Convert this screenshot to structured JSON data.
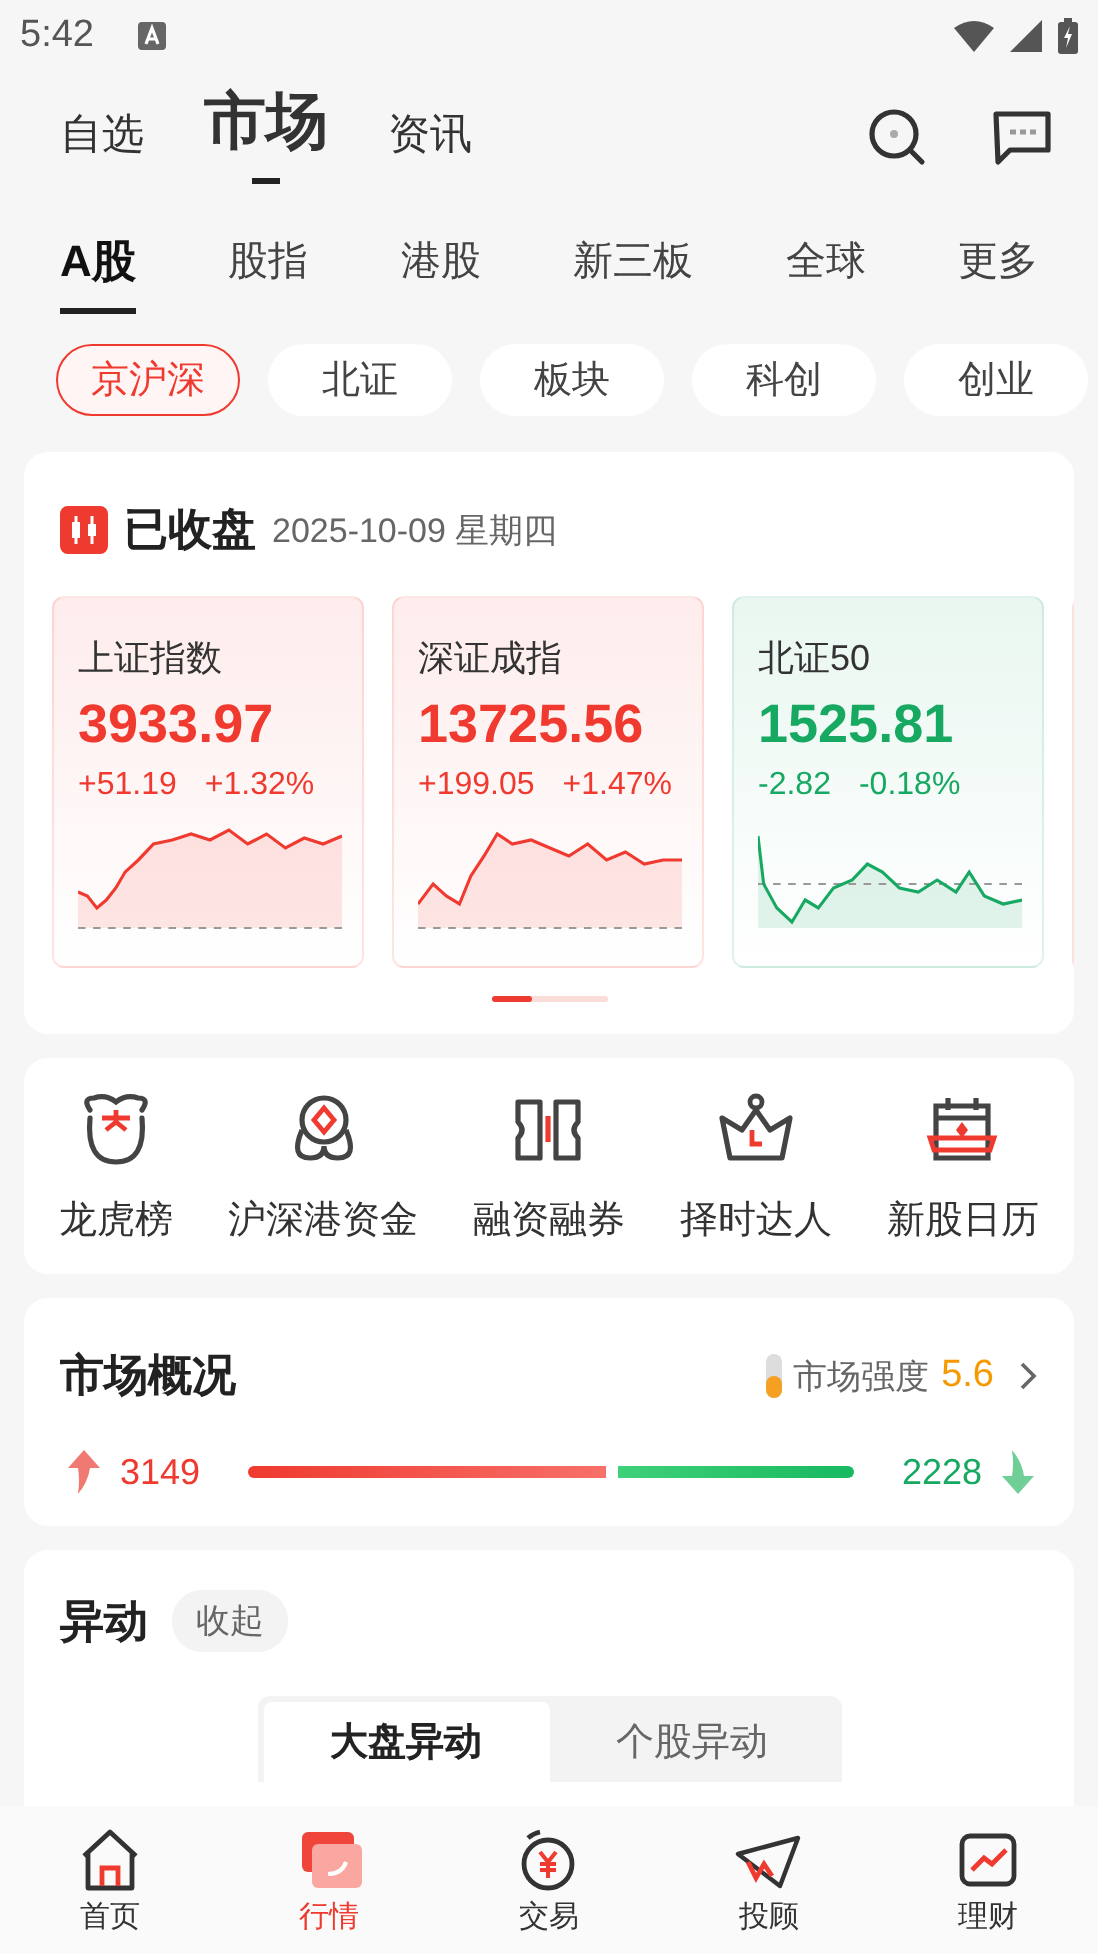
{
  "status_bar": {
    "time": "5:42"
  },
  "header_tabs": [
    {
      "label": "自选",
      "selected": false
    },
    {
      "label": "市场",
      "selected": true
    },
    {
      "label": "资讯",
      "selected": false
    }
  ],
  "market_tabs": [
    {
      "label": "A股",
      "selected": true
    },
    {
      "label": "股指",
      "selected": false
    },
    {
      "label": "港股",
      "selected": false
    },
    {
      "label": "新三板",
      "selected": false
    },
    {
      "label": "全球",
      "selected": false
    },
    {
      "label": "更多",
      "selected": false
    }
  ],
  "sub_tabs": [
    {
      "label": "京沪深",
      "selected": true
    },
    {
      "label": "北证",
      "selected": false
    },
    {
      "label": "板块",
      "selected": false
    },
    {
      "label": "科创",
      "selected": false
    },
    {
      "label": "创业",
      "selected": false
    }
  ],
  "session": {
    "status": "已收盘",
    "date": "2025-10-09 星期四"
  },
  "indices": [
    {
      "name": "上证指数",
      "value": "3933.97",
      "change": "+51.19",
      "percent": "+1.32%",
      "color": "#f0392f"
    },
    {
      "name": "深证成指",
      "value": "13725.56",
      "change": "+199.05",
      "percent": "+1.47%",
      "color": "#f0392f"
    },
    {
      "name": "北证50",
      "value": "1525.81",
      "change": "-2.82",
      "percent": "-0.18%",
      "color": "#17a862"
    }
  ],
  "shortcuts": [
    {
      "label": "龙虎榜"
    },
    {
      "label": "沪深港资金"
    },
    {
      "label": "融资融券"
    },
    {
      "label": "择时达人"
    },
    {
      "label": "新股日历"
    }
  ],
  "overview": {
    "title": "市场概况",
    "strength_label": "市场强度",
    "strength_value": "5.6",
    "rising": "3149",
    "falling": "2228"
  },
  "movers": {
    "title": "异动",
    "collapse": "收起",
    "tabs": [
      {
        "label": "大盘异动",
        "selected": true
      },
      {
        "label": "个股异动",
        "selected": false
      }
    ]
  },
  "bottom_nav": [
    {
      "label": "首页",
      "selected": false
    },
    {
      "label": "行情",
      "selected": true
    },
    {
      "label": "交易",
      "selected": false
    },
    {
      "label": "投顾",
      "selected": false
    },
    {
      "label": "理财",
      "selected": false
    }
  ]
}
